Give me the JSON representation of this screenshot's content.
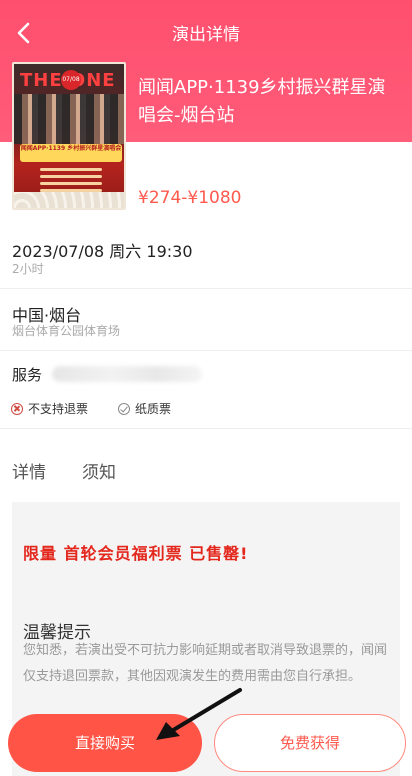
{
  "nav": {
    "title": "演出详情",
    "back_icon": "chevron-left-icon"
  },
  "event": {
    "title": "闻闻APP·1139乡村振兴群星演唱会-烟台站",
    "price_range": "¥274-¥1080",
    "poster": {
      "headline": "THE ONE",
      "date_badge": "07/08",
      "band_text": "闻闻APP·1139 乡村振兴群星演唱会"
    }
  },
  "schedule": {
    "datetime": "2023/07/08 周六 19:30",
    "duration": "2小时"
  },
  "venue": {
    "city": "中国·烟台",
    "name": "烟台体育公园体育场"
  },
  "service": {
    "label": "服务"
  },
  "tags": [
    {
      "label": "不支持退票",
      "icon": "x-circle-icon"
    },
    {
      "label": "纸质票",
      "icon": "check-circle-icon"
    }
  ],
  "tabs": [
    {
      "label": "详情"
    },
    {
      "label": "须知"
    }
  ],
  "content": {
    "promo": "限量 首轮会员福利票 已售罄!",
    "notice_title": "温馨提示",
    "notice_body": "您知悉，若演出受不可抗力影响延期或者取消导致退票的，闻闻仅支持退回票款，其他因观演发生的费用需由您自行承担。"
  },
  "actions": {
    "buy_label": "直接购买",
    "free_label": "免费获得"
  },
  "colors": {
    "header": "#ff4f6e",
    "accent": "#ff5446",
    "promo": "#e3271d"
  }
}
